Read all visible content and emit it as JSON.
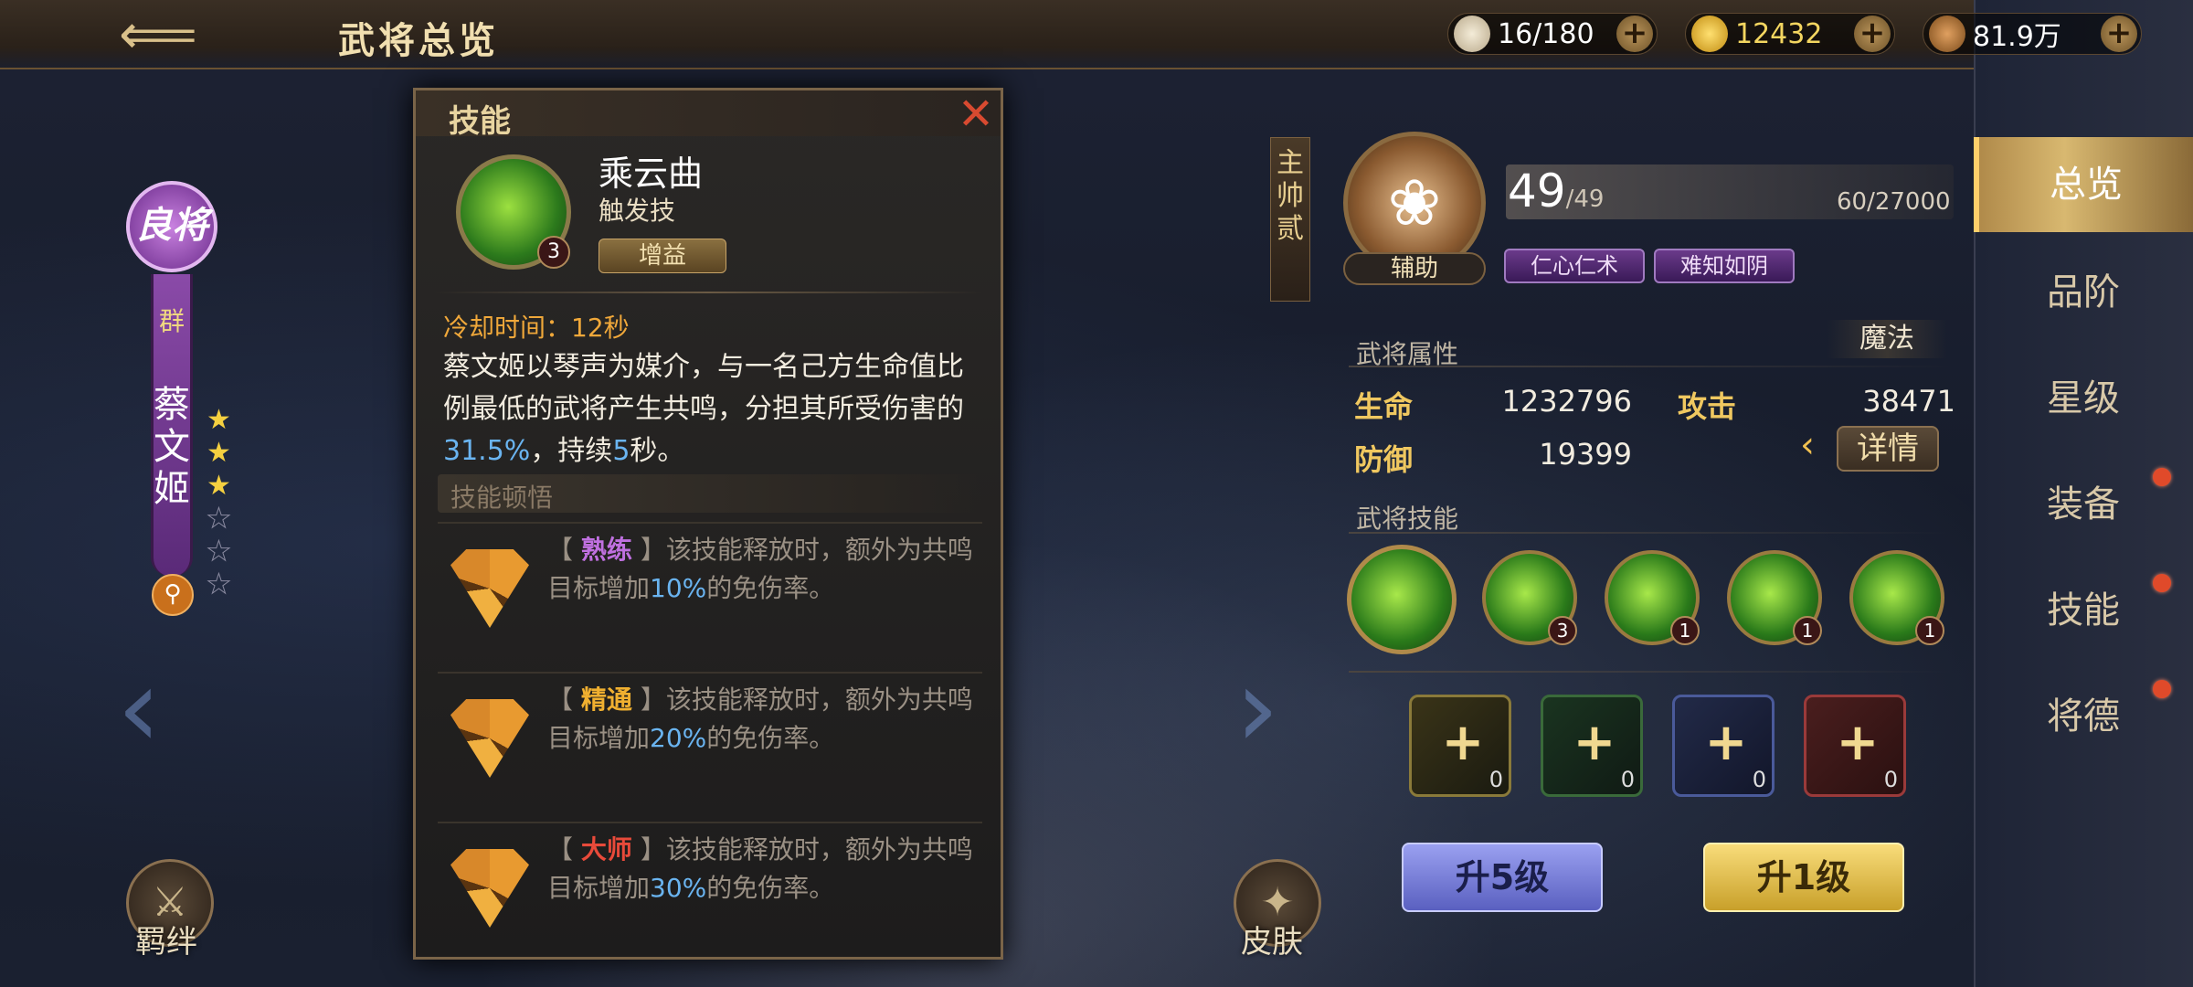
{
  "header": {
    "title": "武将总览"
  },
  "resources": [
    {
      "icon": "stamina-egg-icon",
      "value": "16/180"
    },
    {
      "icon": "gold-ingot-icon",
      "value": "12432"
    },
    {
      "icon": "copper-coin-icon",
      "value": "81.9万"
    }
  ],
  "hero": {
    "rank": "良将",
    "faction": "群",
    "name": "蔡文姬",
    "stars_filled": 3,
    "stars_total": 6
  },
  "left_buttons": {
    "bond": "羁绊",
    "skin": "皮肤"
  },
  "skill_popup": {
    "header": "技能",
    "name": "乘云曲",
    "type": "触发技",
    "tag": "增益",
    "level": "3",
    "cooldown": "冷却时间：12秒",
    "desc_pre": "蔡文姬以琴声为媒介，与一名己方生命值比例最低的武将产生共鸣，分担其所受伤害的",
    "desc_pct": "31.5%",
    "desc_mid": "，持续",
    "desc_sec": "5",
    "desc_end": "秒。",
    "section": "技能顿悟",
    "tiers": [
      {
        "name": "熟练",
        "color": "#c070e0",
        "pre": "该技能释放时，额外为共鸣目标增加",
        "pct": "10%",
        "post": "的免伤率。"
      },
      {
        "name": "精通",
        "color": "#f0b030",
        "pre": "该技能释放时，额外为共鸣目标增加",
        "pct": "20%",
        "post": "的免伤率。"
      },
      {
        "name": "大师",
        "color": "#e84a3a",
        "pre": "该技能释放时，额外为共鸣目标增加",
        "pct": "30%",
        "post": "的免伤率。"
      }
    ]
  },
  "right": {
    "main_label": "主帅贰",
    "role": "辅助",
    "level": "49",
    "level_max": "/49",
    "exp": "60/27000",
    "traits": [
      "仁心仁术",
      "难知如阴"
    ],
    "attr_title": "武将属性",
    "attr_type": "魔法",
    "stats": {
      "hp_label": "生命",
      "hp": "1232796",
      "atk_label": "攻击",
      "atk": "38471",
      "def_label": "防御",
      "def": "19399"
    },
    "detail": "详情",
    "skills_title": "武将技能",
    "skill_levels": [
      "",
      "3",
      "1",
      "1",
      "1"
    ],
    "gems": [
      {
        "color": "#8a7a3a",
        "count": "0"
      },
      {
        "color": "#3a6a3a",
        "count": "0"
      },
      {
        "color": "#4a5a9a",
        "count": "0"
      },
      {
        "color": "#9a3a3a",
        "count": "0"
      }
    ],
    "up5": "升5级",
    "up1": "升1级"
  },
  "menu": [
    "总览",
    "品阶",
    "星级",
    "装备",
    "技能",
    "将德"
  ]
}
